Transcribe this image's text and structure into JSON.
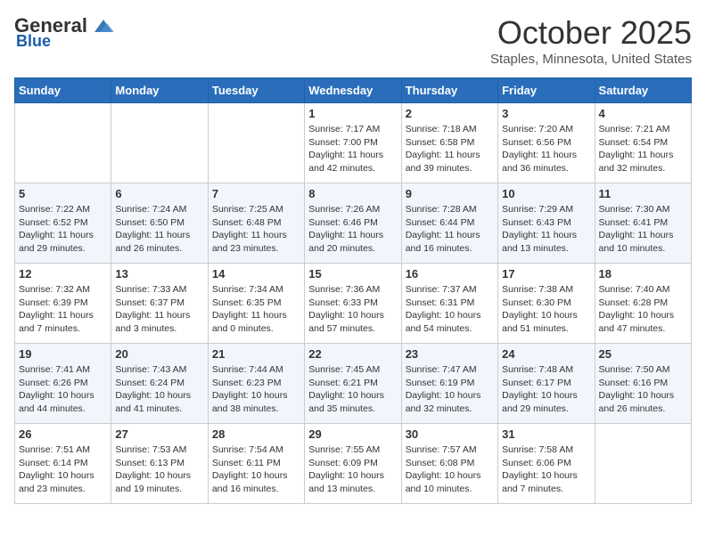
{
  "header": {
    "logo_general": "General",
    "logo_blue": "Blue",
    "month": "October 2025",
    "location": "Staples, Minnesota, United States"
  },
  "days_of_week": [
    "Sunday",
    "Monday",
    "Tuesday",
    "Wednesday",
    "Thursday",
    "Friday",
    "Saturday"
  ],
  "weeks": [
    [
      {
        "day": "",
        "sunrise": "",
        "sunset": "",
        "daylight": ""
      },
      {
        "day": "",
        "sunrise": "",
        "sunset": "",
        "daylight": ""
      },
      {
        "day": "",
        "sunrise": "",
        "sunset": "",
        "daylight": ""
      },
      {
        "day": "1",
        "sunrise": "Sunrise: 7:17 AM",
        "sunset": "Sunset: 7:00 PM",
        "daylight": "Daylight: 11 hours and 42 minutes."
      },
      {
        "day": "2",
        "sunrise": "Sunrise: 7:18 AM",
        "sunset": "Sunset: 6:58 PM",
        "daylight": "Daylight: 11 hours and 39 minutes."
      },
      {
        "day": "3",
        "sunrise": "Sunrise: 7:20 AM",
        "sunset": "Sunset: 6:56 PM",
        "daylight": "Daylight: 11 hours and 36 minutes."
      },
      {
        "day": "4",
        "sunrise": "Sunrise: 7:21 AM",
        "sunset": "Sunset: 6:54 PM",
        "daylight": "Daylight: 11 hours and 32 minutes."
      }
    ],
    [
      {
        "day": "5",
        "sunrise": "Sunrise: 7:22 AM",
        "sunset": "Sunset: 6:52 PM",
        "daylight": "Daylight: 11 hours and 29 minutes."
      },
      {
        "day": "6",
        "sunrise": "Sunrise: 7:24 AM",
        "sunset": "Sunset: 6:50 PM",
        "daylight": "Daylight: 11 hours and 26 minutes."
      },
      {
        "day": "7",
        "sunrise": "Sunrise: 7:25 AM",
        "sunset": "Sunset: 6:48 PM",
        "daylight": "Daylight: 11 hours and 23 minutes."
      },
      {
        "day": "8",
        "sunrise": "Sunrise: 7:26 AM",
        "sunset": "Sunset: 6:46 PM",
        "daylight": "Daylight: 11 hours and 20 minutes."
      },
      {
        "day": "9",
        "sunrise": "Sunrise: 7:28 AM",
        "sunset": "Sunset: 6:44 PM",
        "daylight": "Daylight: 11 hours and 16 minutes."
      },
      {
        "day": "10",
        "sunrise": "Sunrise: 7:29 AM",
        "sunset": "Sunset: 6:43 PM",
        "daylight": "Daylight: 11 hours and 13 minutes."
      },
      {
        "day": "11",
        "sunrise": "Sunrise: 7:30 AM",
        "sunset": "Sunset: 6:41 PM",
        "daylight": "Daylight: 11 hours and 10 minutes."
      }
    ],
    [
      {
        "day": "12",
        "sunrise": "Sunrise: 7:32 AM",
        "sunset": "Sunset: 6:39 PM",
        "daylight": "Daylight: 11 hours and 7 minutes."
      },
      {
        "day": "13",
        "sunrise": "Sunrise: 7:33 AM",
        "sunset": "Sunset: 6:37 PM",
        "daylight": "Daylight: 11 hours and 3 minutes."
      },
      {
        "day": "14",
        "sunrise": "Sunrise: 7:34 AM",
        "sunset": "Sunset: 6:35 PM",
        "daylight": "Daylight: 11 hours and 0 minutes."
      },
      {
        "day": "15",
        "sunrise": "Sunrise: 7:36 AM",
        "sunset": "Sunset: 6:33 PM",
        "daylight": "Daylight: 10 hours and 57 minutes."
      },
      {
        "day": "16",
        "sunrise": "Sunrise: 7:37 AM",
        "sunset": "Sunset: 6:31 PM",
        "daylight": "Daylight: 10 hours and 54 minutes."
      },
      {
        "day": "17",
        "sunrise": "Sunrise: 7:38 AM",
        "sunset": "Sunset: 6:30 PM",
        "daylight": "Daylight: 10 hours and 51 minutes."
      },
      {
        "day": "18",
        "sunrise": "Sunrise: 7:40 AM",
        "sunset": "Sunset: 6:28 PM",
        "daylight": "Daylight: 10 hours and 47 minutes."
      }
    ],
    [
      {
        "day": "19",
        "sunrise": "Sunrise: 7:41 AM",
        "sunset": "Sunset: 6:26 PM",
        "daylight": "Daylight: 10 hours and 44 minutes."
      },
      {
        "day": "20",
        "sunrise": "Sunrise: 7:43 AM",
        "sunset": "Sunset: 6:24 PM",
        "daylight": "Daylight: 10 hours and 41 minutes."
      },
      {
        "day": "21",
        "sunrise": "Sunrise: 7:44 AM",
        "sunset": "Sunset: 6:23 PM",
        "daylight": "Daylight: 10 hours and 38 minutes."
      },
      {
        "day": "22",
        "sunrise": "Sunrise: 7:45 AM",
        "sunset": "Sunset: 6:21 PM",
        "daylight": "Daylight: 10 hours and 35 minutes."
      },
      {
        "day": "23",
        "sunrise": "Sunrise: 7:47 AM",
        "sunset": "Sunset: 6:19 PM",
        "daylight": "Daylight: 10 hours and 32 minutes."
      },
      {
        "day": "24",
        "sunrise": "Sunrise: 7:48 AM",
        "sunset": "Sunset: 6:17 PM",
        "daylight": "Daylight: 10 hours and 29 minutes."
      },
      {
        "day": "25",
        "sunrise": "Sunrise: 7:50 AM",
        "sunset": "Sunset: 6:16 PM",
        "daylight": "Daylight: 10 hours and 26 minutes."
      }
    ],
    [
      {
        "day": "26",
        "sunrise": "Sunrise: 7:51 AM",
        "sunset": "Sunset: 6:14 PM",
        "daylight": "Daylight: 10 hours and 23 minutes."
      },
      {
        "day": "27",
        "sunrise": "Sunrise: 7:53 AM",
        "sunset": "Sunset: 6:13 PM",
        "daylight": "Daylight: 10 hours and 19 minutes."
      },
      {
        "day": "28",
        "sunrise": "Sunrise: 7:54 AM",
        "sunset": "Sunset: 6:11 PM",
        "daylight": "Daylight: 10 hours and 16 minutes."
      },
      {
        "day": "29",
        "sunrise": "Sunrise: 7:55 AM",
        "sunset": "Sunset: 6:09 PM",
        "daylight": "Daylight: 10 hours and 13 minutes."
      },
      {
        "day": "30",
        "sunrise": "Sunrise: 7:57 AM",
        "sunset": "Sunset: 6:08 PM",
        "daylight": "Daylight: 10 hours and 10 minutes."
      },
      {
        "day": "31",
        "sunrise": "Sunrise: 7:58 AM",
        "sunset": "Sunset: 6:06 PM",
        "daylight": "Daylight: 10 hours and 7 minutes."
      },
      {
        "day": "",
        "sunrise": "",
        "sunset": "",
        "daylight": ""
      }
    ]
  ]
}
